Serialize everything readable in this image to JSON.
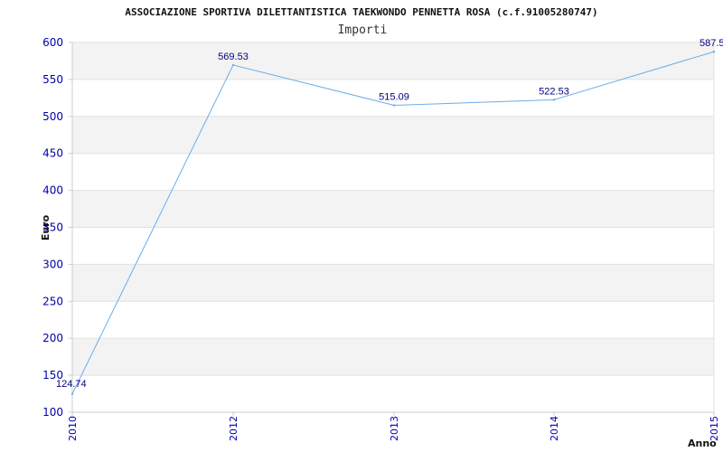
{
  "chart_data": {
    "type": "line",
    "title": "ASSOCIAZIONE SPORTIVA DILETTANTISTICA TAEKWONDO PENNETTA ROSA (c.f.91005280747)",
    "subtitle": "Importi",
    "xlabel": "Anno",
    "ylabel": "Euro",
    "x": [
      "2010",
      "2012",
      "2013",
      "2014",
      "2015"
    ],
    "series": [
      {
        "values": [
          124.74,
          569.53,
          515.09,
          522.53,
          587.5
        ]
      }
    ],
    "data_labels": [
      "124.74",
      "569.53",
      "515.09",
      "522.53",
      "587.5"
    ],
    "ylim": [
      100,
      600
    ],
    "yticks": [
      "100",
      "150",
      "200",
      "250",
      "300",
      "350",
      "400",
      "450",
      "500",
      "550",
      "600"
    ],
    "grid": "horizontal bands",
    "colors": {
      "line": "#6aaee8",
      "band": "#f3f3f3",
      "tick_text": "#0000aa",
      "label_text": "#000080"
    }
  }
}
